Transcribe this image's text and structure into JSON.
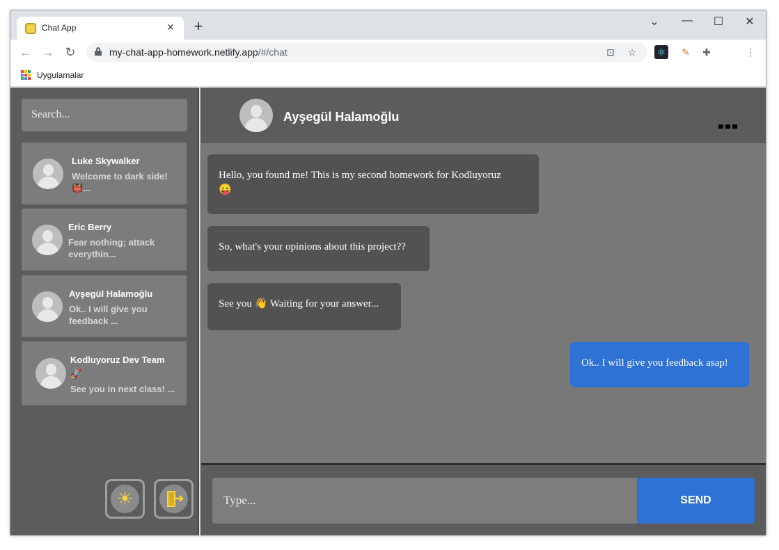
{
  "browser": {
    "tab_title": "Chat App",
    "url_host": "my-chat-app-homework.netlify.app",
    "url_path": "/#/chat",
    "bookmarks_label": "Uygulamalar"
  },
  "sidebar": {
    "search_placeholder": "Search...",
    "contacts": [
      {
        "name": "Luke Skywalker",
        "preview_line1": "Welcome to dark side!",
        "preview_line2": "👹..."
      },
      {
        "name": "Eric Berry",
        "preview_line1": "Fear nothing; attack",
        "preview_line2": "everythin..."
      },
      {
        "name": "Ayşegül Halamoğlu",
        "preview_line1": "Ok.. I will give you",
        "preview_line2": "feedback ..."
      },
      {
        "name": "Kodluyoruz Dev Team",
        "name_emoji": "🚀",
        "preview_line1": "See you in next class! ..."
      }
    ]
  },
  "chat": {
    "contact_name": "Ayşegül Halamoğlu",
    "messages": [
      {
        "text_line1": "Hello, you found me! This is my second homework for Kodluyoruz",
        "text_line2": "😛",
        "from": "them"
      },
      {
        "text_line1": "So, what's your opinions about this project??",
        "from": "them"
      },
      {
        "text_line1": "See you 👋 Waiting for your answer...",
        "from": "them"
      },
      {
        "text_line1": "Ok.. I will give you feedback asap!",
        "from": "me"
      }
    ],
    "input_placeholder": "Type...",
    "send_label": "SEND"
  },
  "colors": {
    "accent": "#2f72d6",
    "panel": "#5c5c5c",
    "message_area": "#787878",
    "bubble_them": "#525252",
    "icon_yellow": "#f7d43a"
  },
  "icons": {
    "theme_toggle": "sun-icon",
    "logout": "exit-door-icon"
  }
}
